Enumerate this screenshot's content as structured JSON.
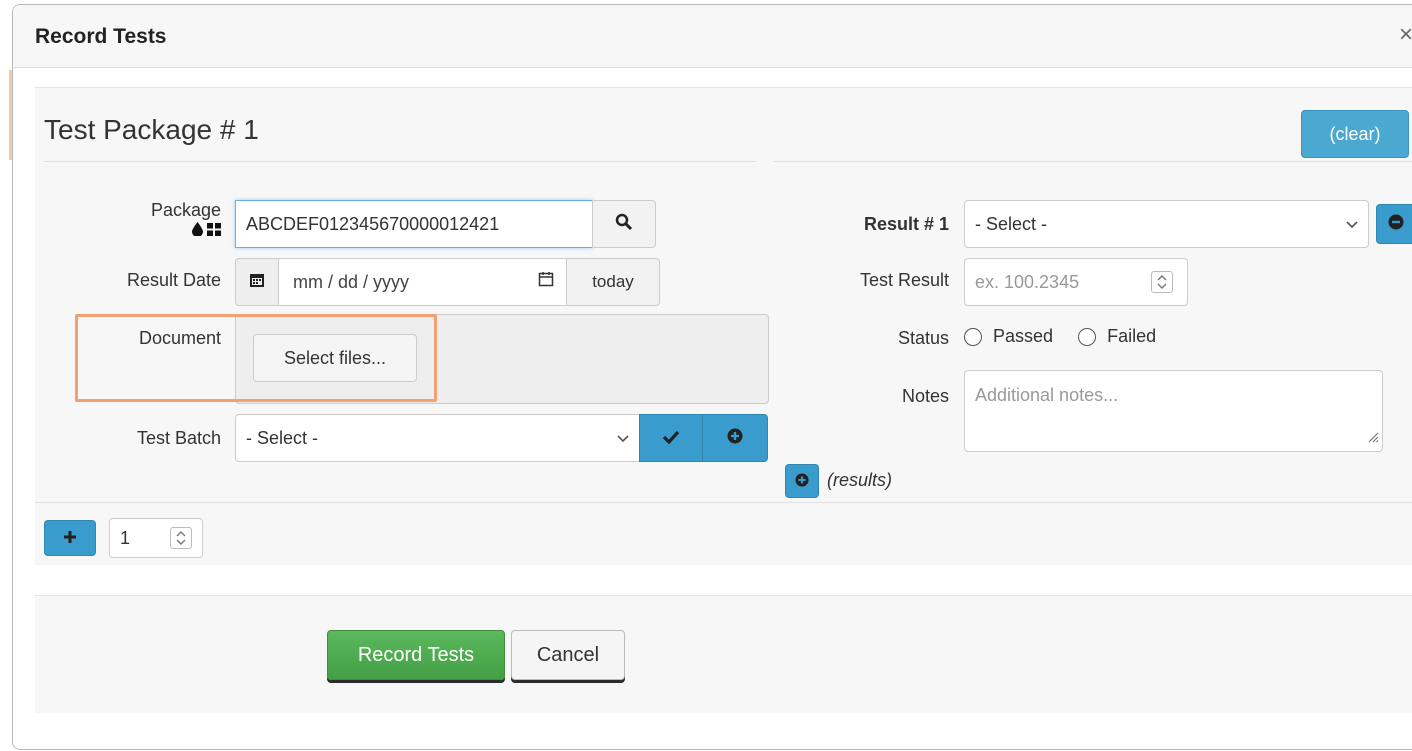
{
  "modal": {
    "title": "Record Tests",
    "close_glyph": "×"
  },
  "package": {
    "heading": "Test Package # 1",
    "clear_label": "(clear)",
    "package_label": "Package",
    "package_value": "ABCDEF012345670000012421",
    "result_date_label": "Result Date",
    "result_date_placeholder": "mm / dd / yyyy",
    "today_label": "today",
    "document_label": "Document",
    "select_files_label": "Select files...",
    "test_batch_label": "Test Batch",
    "test_batch_value": "- Select -"
  },
  "result": {
    "label": "Result # 1",
    "select_value": "- Select -",
    "test_result_label": "Test Result",
    "test_result_placeholder": "ex. 100.2345",
    "status_label": "Status",
    "status_options": [
      "Passed",
      "Failed"
    ],
    "notes_label": "Notes",
    "notes_placeholder": "Additional notes...",
    "add_results_label": "(results)"
  },
  "packages_count": {
    "value": "1"
  },
  "footer": {
    "record_label": "Record Tests",
    "cancel_label": "Cancel"
  },
  "colors": {
    "primary": "#3a9ccc",
    "success": "#5cb85c",
    "highlight": "#f5a070"
  }
}
